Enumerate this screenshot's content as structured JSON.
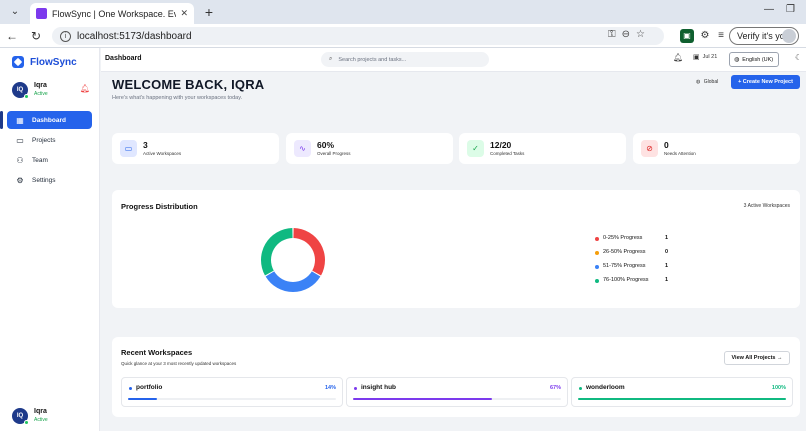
{
  "browser": {
    "tab_title": "FlowSync | One Workspace. Every",
    "tab_close": "✕",
    "url": "localhost:5173/dashboard",
    "verify_label": "Verify it's you"
  },
  "app": {
    "brand": "FlowSync",
    "user": {
      "initials": "IQ",
      "name": "Iqra",
      "status": "Active"
    },
    "nav": [
      {
        "label": "Dashboard",
        "icon": "grid-icon"
      },
      {
        "label": "Projects",
        "icon": "folder-icon"
      },
      {
        "label": "Team",
        "icon": "users-icon"
      },
      {
        "label": "Settings",
        "icon": "gear-icon"
      }
    ]
  },
  "header": {
    "breadcrumb": "Dashboard",
    "search_placeholder": "Search projects and tasks...",
    "date": "Jul 21",
    "language": "English (UK)"
  },
  "main": {
    "welcome": "WELCOME BACK, IQRA",
    "subtitle": "Here's what's happening with your workspaces today.",
    "global_label": "Global",
    "create_label": "+ Create New Project",
    "stats": [
      {
        "value": "3",
        "label": "Active Workspaces",
        "icon": "monitor-icon",
        "color": "#2563eb",
        "bg": "#e0e7ff"
      },
      {
        "value": "60%",
        "label": "Overall Progress",
        "icon": "activity-icon",
        "color": "#7c3aed",
        "bg": "#ede9fe"
      },
      {
        "value": "12/20",
        "label": "Completed Tasks",
        "icon": "check-icon",
        "color": "#16a34a",
        "bg": "#dcfce7"
      },
      {
        "value": "0",
        "label": "Needs Attention",
        "icon": "alert-icon",
        "color": "#dc2626",
        "bg": "#fee2e2"
      }
    ]
  },
  "distribution": {
    "title": "Progress Distribution",
    "meta": "3 Active Workspaces",
    "legend": [
      {
        "label": "0-25% Progress",
        "count": "1",
        "color": "#ef4444"
      },
      {
        "label": "26-50% Progress",
        "count": "0",
        "color": "#f59e0b"
      },
      {
        "label": "51-75% Progress",
        "count": "1",
        "color": "#3b82f6"
      },
      {
        "label": "76-100% Progress",
        "count": "1",
        "color": "#10b981"
      }
    ]
  },
  "chart_data": {
    "type": "pie",
    "categories": [
      "0-25% Progress",
      "26-50% Progress",
      "51-75% Progress",
      "76-100% Progress"
    ],
    "values": [
      1,
      0,
      1,
      1
    ],
    "colors": [
      "#ef4444",
      "#f59e0b",
      "#3b82f6",
      "#10b981"
    ],
    "title": "Progress Distribution",
    "legend": "right"
  },
  "recent": {
    "title": "Recent Workspaces",
    "subtitle": "Quick glance at your 3 most recently updated workspaces",
    "view_all": "View All Projects →",
    "items": [
      {
        "name": "portfolio",
        "percent": "14%",
        "progress": 0.14,
        "color": "#2563eb"
      },
      {
        "name": "insight hub",
        "percent": "67%",
        "progress": 0.67,
        "color": "#7c3aed"
      },
      {
        "name": "wonderloom",
        "percent": "100%",
        "progress": 1.0,
        "color": "#10b981"
      }
    ]
  }
}
